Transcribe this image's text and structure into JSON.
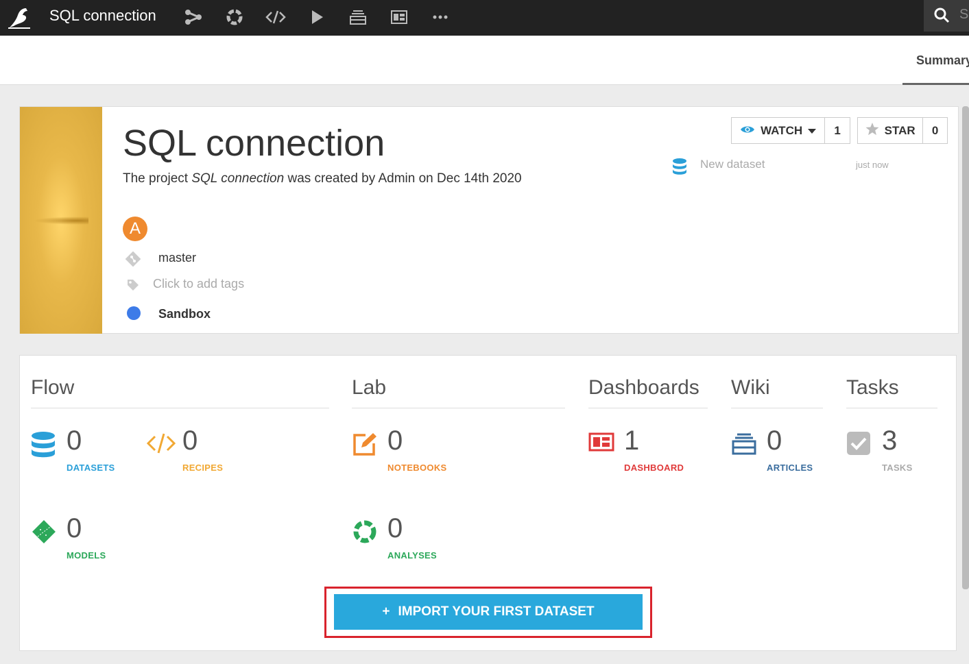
{
  "topbar": {
    "project_title": "SQL connection",
    "nav_icons": [
      "flow-icon",
      "analyses-icon",
      "code-icon",
      "run-icon",
      "wiki-icon",
      "dashboard-icon",
      "more-icon"
    ],
    "search_placeholder": "Se"
  },
  "subbar": {
    "tab_summary": "Summary"
  },
  "project": {
    "title": "SQL connection",
    "desc_prefix": "The project ",
    "desc_name": "SQL connection",
    "desc_suffix": " was created by Admin on Dec 14th 2020",
    "avatar_letter": "A",
    "branch": "master",
    "tags_placeholder": "Click to add tags",
    "status": "Sandbox",
    "status_color": "#3d7be8"
  },
  "social": {
    "watch_label": "WATCH",
    "watch_count": "1",
    "star_label": "STAR",
    "star_count": "0"
  },
  "activity": {
    "text": "New dataset",
    "time": "just now"
  },
  "sections": {
    "flow": "Flow",
    "lab": "Lab",
    "dashboards": "Dashboards",
    "wiki": "Wiki",
    "tasks": "Tasks"
  },
  "stats": {
    "datasets": {
      "value": "0",
      "label": "DATASETS",
      "color": "#2a9fd8"
    },
    "recipes": {
      "value": "0",
      "label": "RECIPES",
      "color": "#f1a833"
    },
    "models": {
      "value": "0",
      "label": "MODELS",
      "color": "#2ca85a"
    },
    "notebooks": {
      "value": "0",
      "label": "NOTEBOOKS",
      "color": "#ef8a2f"
    },
    "analyses": {
      "value": "0",
      "label": "ANALYSES",
      "color": "#2ca85a"
    },
    "dashboard": {
      "value": "1",
      "label": "DASHBOARD",
      "color": "#e03a3a"
    },
    "articles": {
      "value": "0",
      "label": "ARTICLES",
      "color": "#3a6d9e"
    },
    "tasks": {
      "value": "3",
      "label": "TASKS",
      "color": "#aaaaaa"
    }
  },
  "cta": {
    "plus": "+",
    "label": "IMPORT YOUR FIRST DATASET"
  }
}
